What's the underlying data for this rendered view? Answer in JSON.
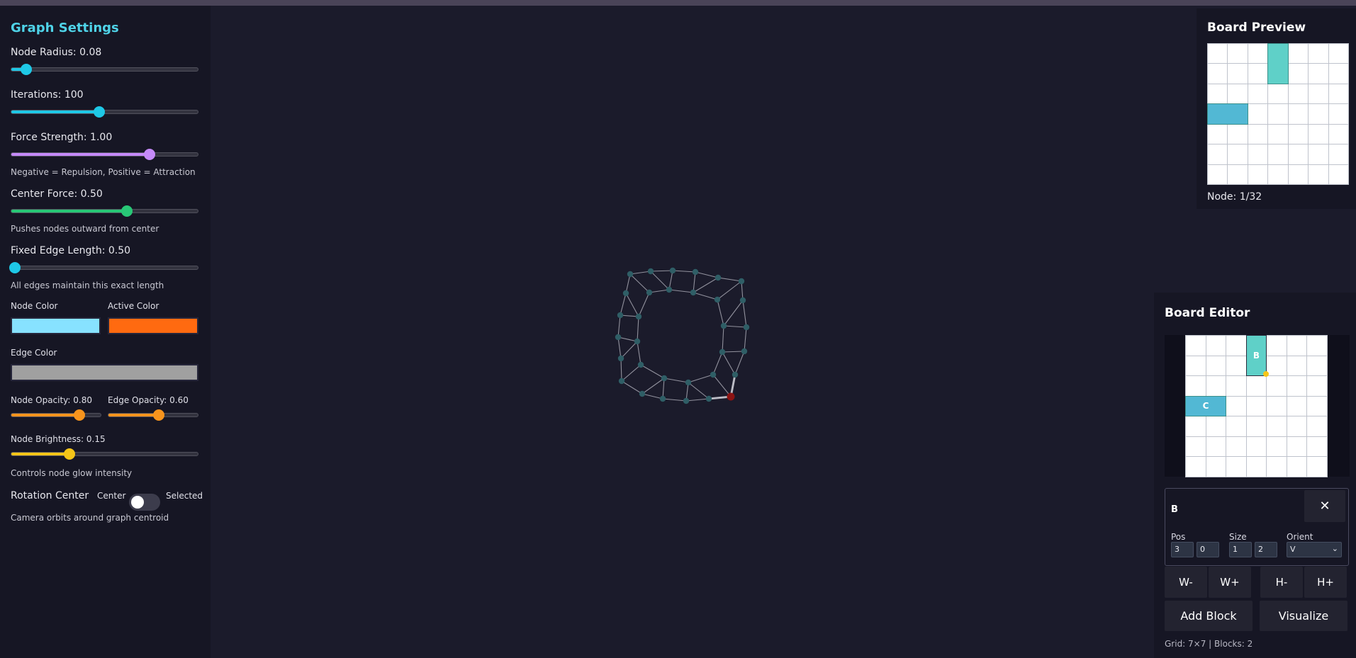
{
  "colors": {
    "accent": "#4fd3e8",
    "node": "#87e2ff",
    "active": "#ff6a10",
    "edge": "#a0a0a0",
    "slider_cyan": "#1ec8e6",
    "slider_purple": "#c58af9",
    "slider_green": "#28c776",
    "slider_orange": "#f7941d",
    "slider_yellow": "#f5c518",
    "block_b": "#5fd0c8",
    "block_c": "#52b8d4",
    "graph_node": "#2f5e66",
    "graph_selected": "#8b1414"
  },
  "settings": {
    "title": "Graph Settings",
    "node_radius": {
      "label": "Node Radius: 0.08",
      "level": 0.08
    },
    "iterations": {
      "label": "Iterations: 100",
      "level": 0.47
    },
    "force_strength": {
      "label": "Force Strength: 1.00",
      "level": 0.74,
      "note": "Negative = Repulsion, Positive = Attraction"
    },
    "center_force": {
      "label": "Center Force: 0.50",
      "level": 0.62,
      "note": "Pushes nodes outward from center"
    },
    "fixed_edge_length": {
      "label": "Fixed Edge Length: 0.50",
      "level": 0.0,
      "note": "All edges maintain this exact length"
    },
    "node_color_label": "Node Color",
    "active_color_label": "Active Color",
    "edge_color_label": "Edge Color",
    "node_opacity": {
      "label": "Node Opacity: 0.80",
      "level": 0.76
    },
    "edge_opacity": {
      "label": "Edge Opacity: 0.60",
      "level": 0.56
    },
    "node_brightness": {
      "label": "Node Brightness: 0.15",
      "level": 0.31,
      "note": "Controls node glow intensity"
    },
    "rotation": {
      "label": "Rotation Center",
      "left": "Center",
      "right": "Selected",
      "note": "Camera orbits around graph centroid",
      "selected": false
    }
  },
  "preview": {
    "title": "Board Preview",
    "node_label": "Node: 1/32"
  },
  "board": {
    "cols": 7,
    "rows": 7,
    "blocks": [
      {
        "name": "B",
        "x": 3,
        "y": 0,
        "w": 1,
        "h": 2,
        "color": "#5fd0c8"
      },
      {
        "name": "C",
        "x": 0,
        "y": 3,
        "w": 2,
        "h": 1,
        "color": "#52b8d4"
      }
    ]
  },
  "editor": {
    "title": "Board Editor",
    "selected": "B",
    "close_icon": "✕",
    "pos_label": "Pos",
    "pos_x": "3",
    "pos_y": "0",
    "size_label": "Size",
    "size_w": "1",
    "size_h": "2",
    "orient_label": "Orient",
    "orient_value": "V",
    "w_minus": "W-",
    "w_plus": "W+",
    "h_minus": "H-",
    "h_plus": "H+",
    "add_block": "Add Block",
    "visualize": "Visualize",
    "footer": "Grid: 7×7 | Blocks: 2"
  }
}
